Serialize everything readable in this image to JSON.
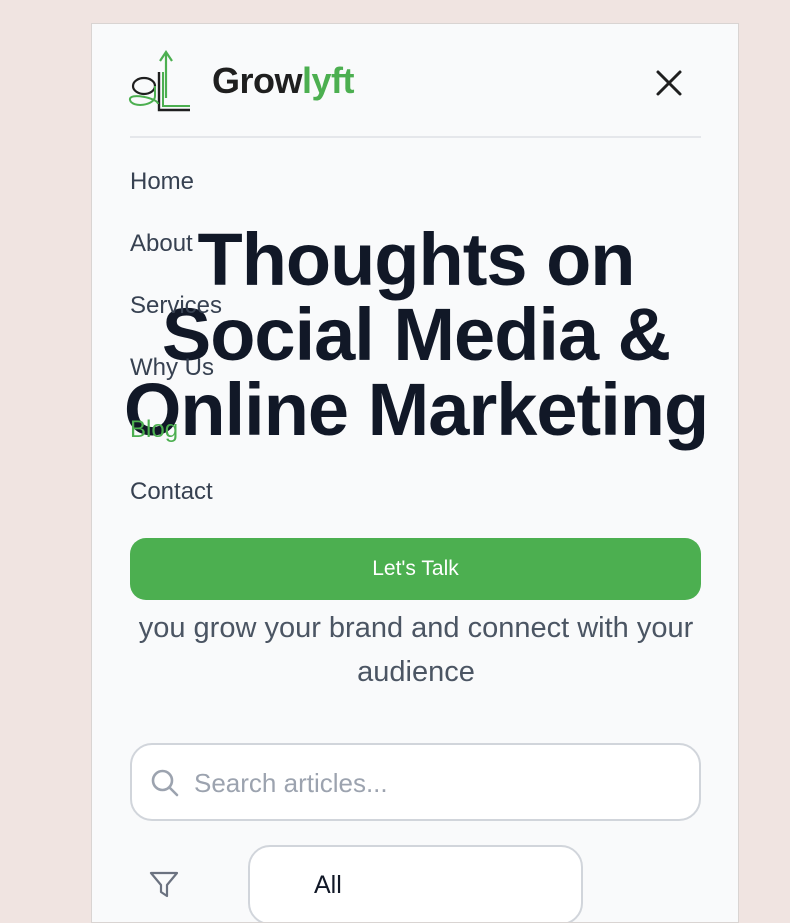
{
  "header": {
    "brand_main": "Grow",
    "brand_accent": "lyft",
    "logo_text": "gL"
  },
  "hero": {
    "title": "Thoughts on Social Media & Online Marketing",
    "subtitle": "you grow your brand and connect with your audience"
  },
  "nav": {
    "items": [
      {
        "label": "Home"
      },
      {
        "label": "About"
      },
      {
        "label": "Services"
      },
      {
        "label": "Why Us"
      },
      {
        "label": "Blog"
      },
      {
        "label": "Contact"
      }
    ],
    "active_item": "Blog",
    "cta_label": "Let's Talk"
  },
  "search": {
    "placeholder": "Search articles...",
    "value": ""
  },
  "filter": {
    "selected": "All"
  },
  "colors": {
    "accent": "#4caf50",
    "heading": "#111827",
    "background": "#f0e4e1"
  },
  "icons": {
    "logo": "growlyft-logo-icon",
    "close": "close-icon",
    "search": "search-icon",
    "filter": "filter-icon"
  }
}
